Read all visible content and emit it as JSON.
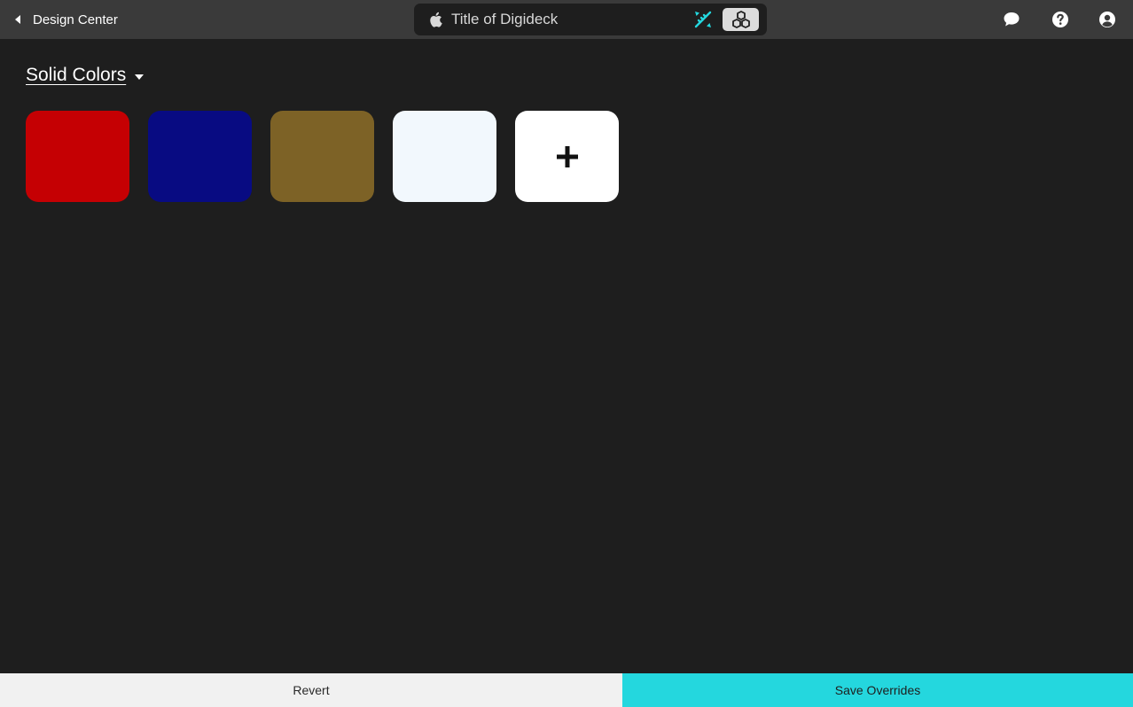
{
  "header": {
    "back_label": "Design Center",
    "deck_title": "Title of Digideck",
    "icons": {
      "back": "caret-left-icon",
      "platform": "apple-icon",
      "design": "pencil-ruler-icon",
      "assets": "boxes-icon",
      "chat": "chat-bubble-icon",
      "help": "help-circle-icon",
      "account": "user-circle-icon"
    },
    "accent_color": "#24d7de"
  },
  "section": {
    "title": "Solid Colors",
    "dropdown_icon": "caret-down-icon"
  },
  "swatches": [
    {
      "name": "red",
      "color": "#c50003"
    },
    {
      "name": "navy",
      "color": "#080b82"
    },
    {
      "name": "olive-brown",
      "color": "#7d6226"
    },
    {
      "name": "off-white",
      "color": "#f2f8fd"
    }
  ],
  "add_swatch": {
    "icon": "plus-icon",
    "color": "#ffffff"
  },
  "footer": {
    "revert_label": "Revert",
    "save_label": "Save Overrides"
  }
}
